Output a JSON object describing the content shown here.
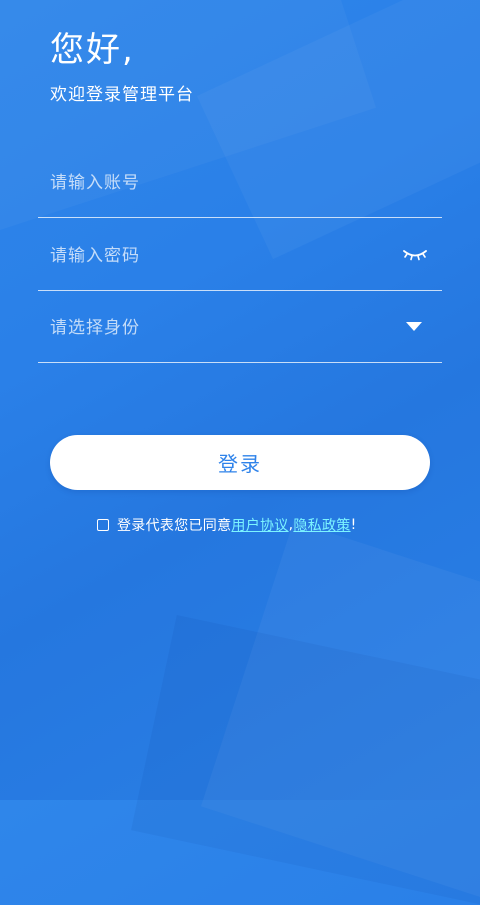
{
  "header": {
    "greeting": "您好,",
    "subtitle": "欢迎登录管理平台"
  },
  "form": {
    "account_placeholder": "请输入账号",
    "password_placeholder": "请输入密码",
    "password_toggle_icon": "eye-closed-icon",
    "role_placeholder": "请选择身份",
    "role_dropdown_icon": "caret-down-icon"
  },
  "actions": {
    "login_label": "登录"
  },
  "agreement": {
    "checked": false,
    "prefix": "登录代表您已同意",
    "user_agreement": "用户协议",
    "separator": ",",
    "privacy_policy": "隐私政策",
    "suffix": "!"
  },
  "colors": {
    "background": "#2a80e8",
    "button_text": "#2f83ea",
    "link": "#7cf4ff"
  }
}
